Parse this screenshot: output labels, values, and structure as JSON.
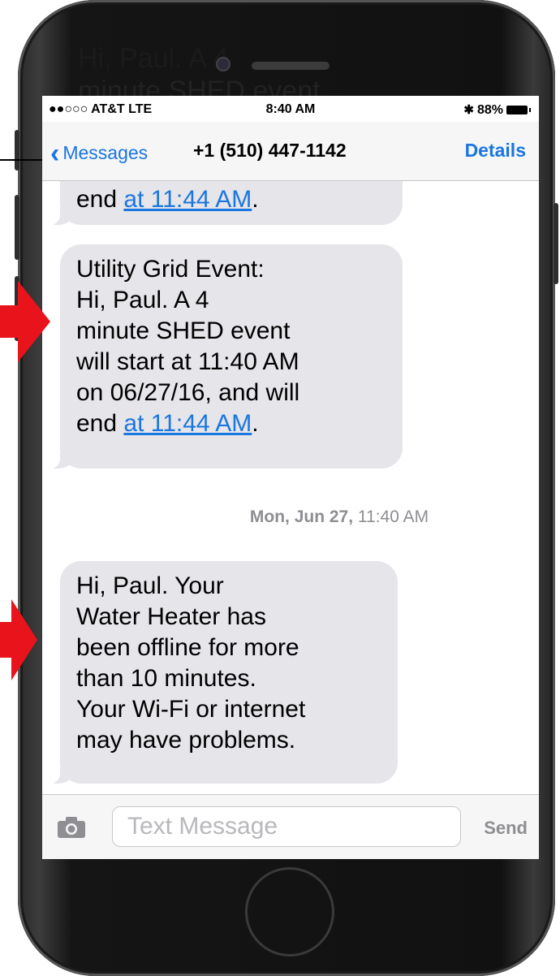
{
  "status_bar": {
    "carrier": "●●○○○ AT&T  LTE",
    "time": "8:40 AM",
    "battery": "88%"
  },
  "nav": {
    "back_label": "Messages",
    "title": "+1 (510) 447-1142",
    "details_label": "Details"
  },
  "ghost_text": {
    "line1": "Hi, Paul. A 4",
    "line2": "minute SHED event"
  },
  "messages": [
    {
      "lines": [
        "end "
      ],
      "link": "at 11:44 AM",
      "after_link": "."
    },
    {
      "lines": [
        "Utility Grid Event:",
        "Hi, Paul. A 4",
        "minute SHED event",
        "will start at 11:40 AM",
        "on 06/27/16, and will",
        "end "
      ],
      "link": "at 11:44 AM",
      "after_link": "."
    },
    {
      "lines": [
        "Hi, Paul. Your",
        "Water Heater has",
        "been offline for more",
        "than 10 minutes.",
        "Your Wi-Fi or internet",
        "may have problems."
      ]
    }
  ],
  "timestamp": {
    "day": "Mon, Jun 27,",
    "time": "11:40 AM"
  },
  "compose": {
    "placeholder": "Text Message",
    "send_label": "Send"
  },
  "colors": {
    "accent": "#1a76e0",
    "bubble": "#e5e5ea",
    "arrow": "#e8131b"
  }
}
